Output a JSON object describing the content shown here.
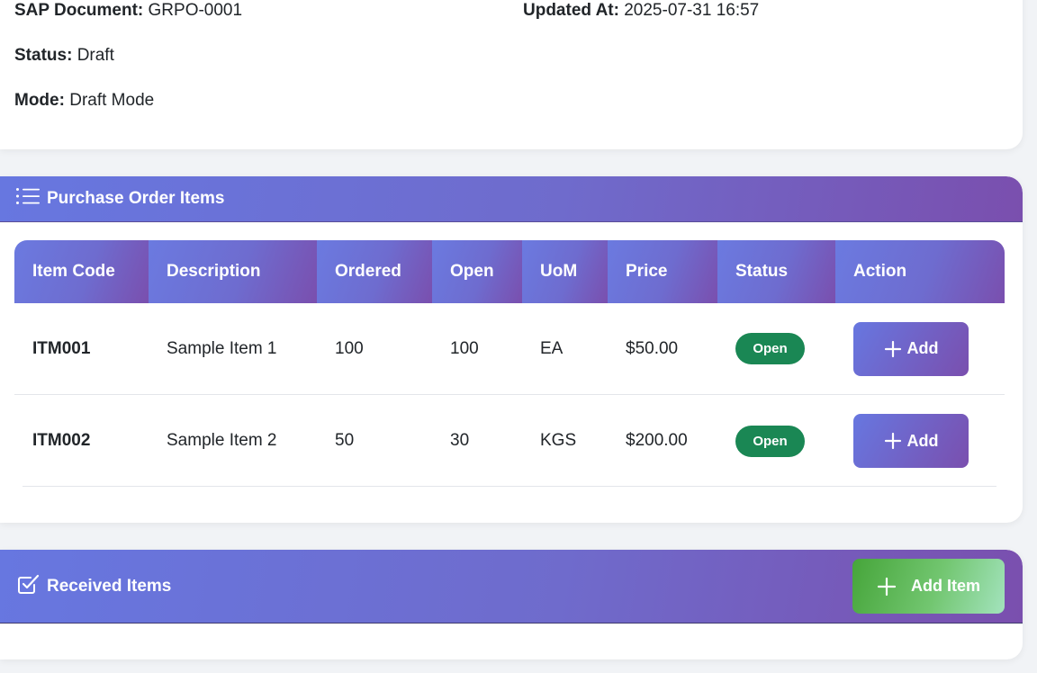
{
  "info": {
    "sap_document_label": "SAP Document:",
    "sap_document_value": "GRPO-0001",
    "updated_at_label": "Updated At:",
    "updated_at_value": "2025-07-31 16:57",
    "status_label": "Status:",
    "status_value": "Draft",
    "mode_label": "Mode:",
    "mode_value": "Draft Mode"
  },
  "po_items": {
    "title": "Purchase Order Items",
    "icon": "list-icon",
    "columns": [
      "Item Code",
      "Description",
      "Ordered",
      "Open",
      "UoM",
      "Price",
      "Status",
      "Action"
    ],
    "rows": [
      {
        "code": "ITM001",
        "description": "Sample Item 1",
        "ordered": "100",
        "open": "100",
        "uom": "EA",
        "price": "$50.00",
        "status": "Open",
        "action": "Add"
      },
      {
        "code": "ITM002",
        "description": "Sample Item 2",
        "ordered": "50",
        "open": "30",
        "uom": "KGS",
        "price": "$200.00",
        "status": "Open",
        "action": "Add"
      }
    ]
  },
  "received": {
    "title": "Received Items",
    "icon": "checkbox-icon",
    "add_item_label": "Add Item"
  },
  "colors": {
    "header_gradient_start": "#6777e0",
    "header_gradient_end": "#7a4fae",
    "status_open": "#1a8754",
    "add_item_green": "#46a53a"
  }
}
